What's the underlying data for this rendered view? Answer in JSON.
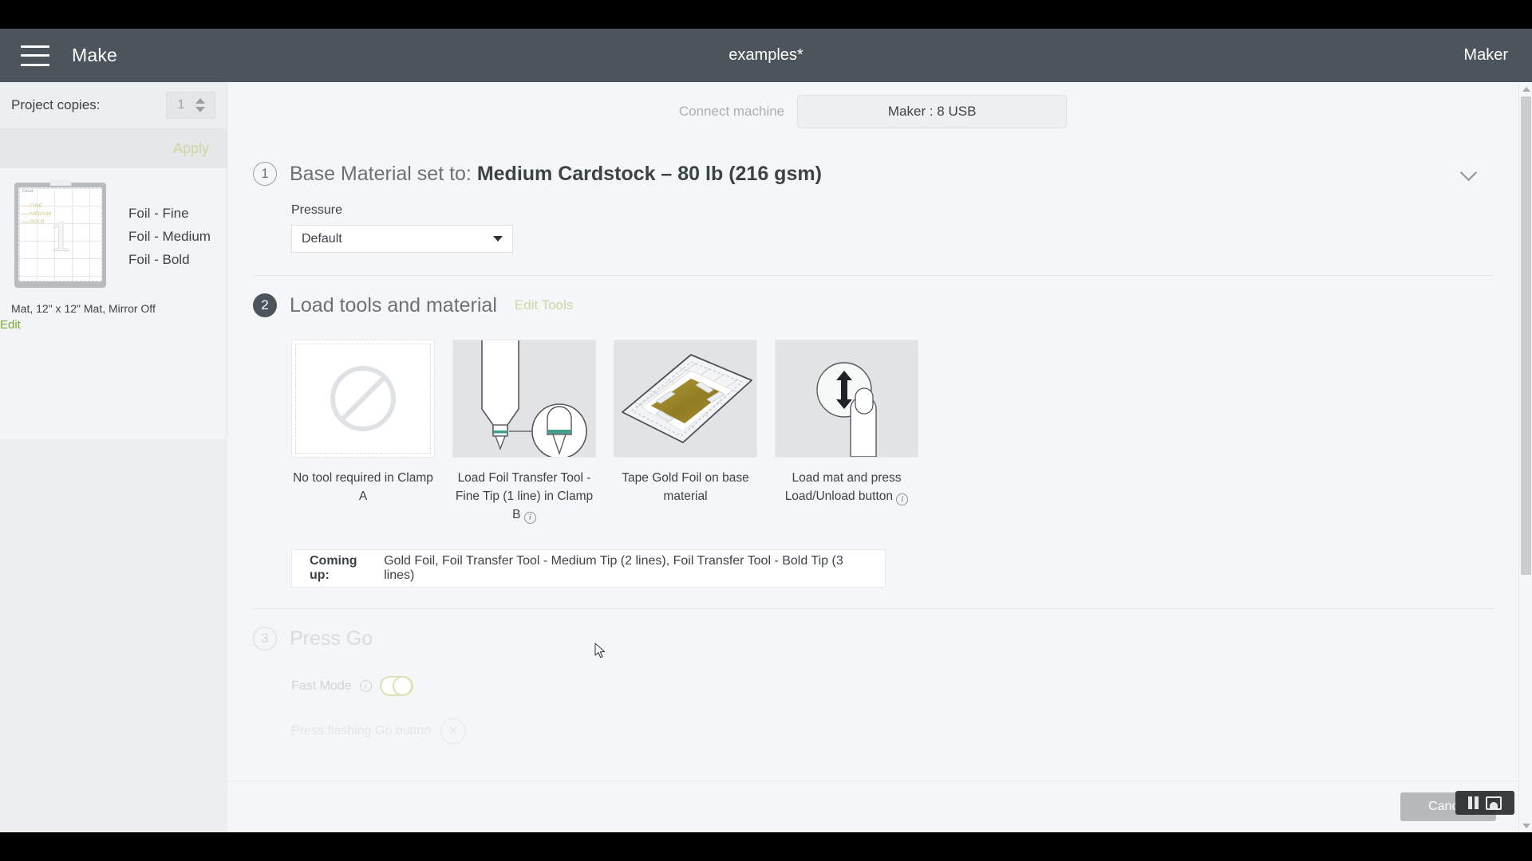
{
  "topbar": {
    "menu_icon": "hamburger-icon",
    "app_title": "Make",
    "document_title": "examples*",
    "machine_label": "Maker"
  },
  "sidebar": {
    "copies_label": "Project copies:",
    "copies_value": "1",
    "apply_label": "Apply",
    "mat_brand": "Cricut",
    "mat_number": "1",
    "mat_labels": [
      "FINE",
      "MEDIUM",
      "BOLD"
    ],
    "tool_list": [
      "Foil - Fine",
      "Foil - Medium",
      "Foil - Bold"
    ],
    "mat_meta": "Mat, 12\" x 12\" Mat, Mirror Off",
    "edit_label": "Edit"
  },
  "connect": {
    "label": "Connect machine",
    "machine_button": "Maker : 8 USB"
  },
  "step1": {
    "number": "1",
    "title_prefix": "Base Material set to: ",
    "material": "Medium Cardstock – 80 lb (216 gsm)",
    "pressure_label": "Pressure",
    "pressure_value": "Default"
  },
  "step2": {
    "number": "2",
    "title": "Load tools and material",
    "edit_tools": "Edit Tools",
    "cards": [
      {
        "icon": "no-tool-icon",
        "caption": "No tool required in Clamp A",
        "has_info": false
      },
      {
        "icon": "foil-transfer-tool-icon",
        "caption": "Load Foil Transfer Tool - Fine Tip (1 line) in Clamp B",
        "has_info": true
      },
      {
        "icon": "gold-foil-on-mat-icon",
        "caption": "Tape Gold Foil on base material",
        "has_info": false
      },
      {
        "icon": "press-load-button-icon",
        "caption": "Load mat and press Load/Unload button",
        "has_info": true
      }
    ],
    "coming_up_label": "Coming up:",
    "coming_up_value": "Gold Foil, Foil Transfer Tool - Medium Tip (2 lines), Foil Transfer Tool - Bold Tip (3 lines)"
  },
  "step3": {
    "number": "3",
    "title": "Press Go",
    "fast_mode_label": "Fast Mode",
    "fast_mode_state": "off",
    "press_go_text": "Press flashing Go button"
  },
  "bottom": {
    "cancel_label": "Cancel"
  },
  "colors": {
    "topbar": "#4c555c",
    "accent_green": "#7aa53c",
    "muted_green": "#cdd6a4",
    "gold_foil": "#9a8426",
    "tool_teal": "#3f9e8d"
  }
}
